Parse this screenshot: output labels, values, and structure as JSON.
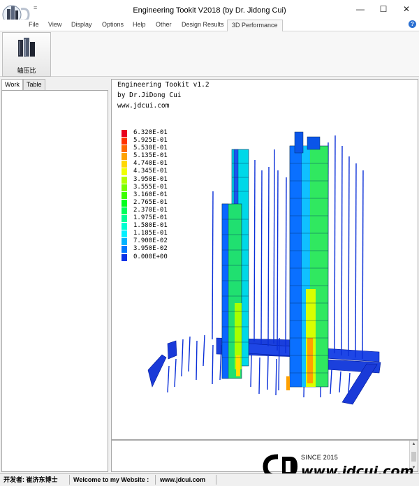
{
  "window": {
    "title": "Engineering Tookit V2018 (by Dr. Jidong Cui)",
    "quick_access": "=",
    "minimize": "—",
    "maximize": "☐",
    "close": "✕"
  },
  "menu": {
    "items": [
      "File",
      "View",
      "Display",
      "Options",
      "Help",
      "Other",
      "Design Results",
      "3D Performance"
    ],
    "active": "3D Performance",
    "help": "?"
  },
  "ribbon": {
    "button_label": "轴压比"
  },
  "left_panel": {
    "tabs": [
      "Work",
      "Table"
    ],
    "active_tab": "Work"
  },
  "viewport": {
    "header": [
      "Engineering Tookit v1.2",
      "by Dr.JiDong Cui",
      "www.jdcui.com"
    ],
    "legend": [
      {
        "value": "6.320E-01",
        "color": "#e8001e"
      },
      {
        "value": "5.925E-01",
        "color": "#ff3200"
      },
      {
        "value": "5.530E-01",
        "color": "#ff6a00"
      },
      {
        "value": "5.135E-01",
        "color": "#ffa200"
      },
      {
        "value": "4.740E-01",
        "color": "#ffd800"
      },
      {
        "value": "4.345E-01",
        "color": "#f0ff00"
      },
      {
        "value": "3.950E-01",
        "color": "#b4ff00"
      },
      {
        "value": "3.555E-01",
        "color": "#78ff00"
      },
      {
        "value": "3.160E-01",
        "color": "#3cff00"
      },
      {
        "value": "2.765E-01",
        "color": "#00ff1e"
      },
      {
        "value": "2.370E-01",
        "color": "#00ff5a"
      },
      {
        "value": "1.975E-01",
        "color": "#00ff96"
      },
      {
        "value": "1.580E-01",
        "color": "#00ffd2"
      },
      {
        "value": "1.185E-01",
        "color": "#00f0ff"
      },
      {
        "value": "7.900E-02",
        "color": "#00b4ff"
      },
      {
        "value": "3.950E-02",
        "color": "#0078ff"
      },
      {
        "value": "0.000E+00",
        "color": "#0a32e6"
      }
    ]
  },
  "watermark": {
    "since": "SINCE 2015",
    "site": "www.jdcui.com"
  },
  "status": {
    "author": "开发者: 崔济东博士",
    "welcome": "Welcome to my Website :",
    "url": "www.jdcui.com"
  }
}
